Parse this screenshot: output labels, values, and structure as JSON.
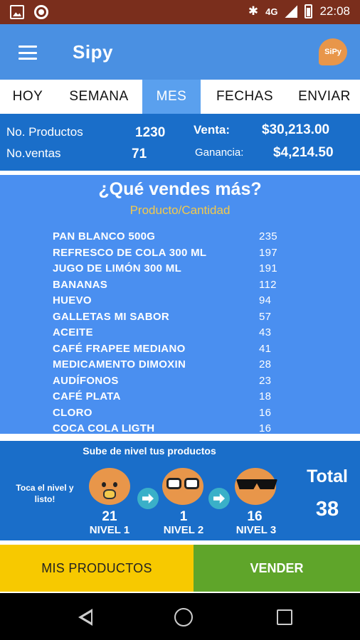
{
  "status_bar": {
    "network": "4G",
    "time": "22:08"
  },
  "app": {
    "title": "Sipy",
    "logo_text": "SiPy"
  },
  "tabs": [
    {
      "label": "HOY",
      "active": false
    },
    {
      "label": "SEMANA",
      "active": false
    },
    {
      "label": "MES",
      "active": true
    },
    {
      "label": "FECHAS",
      "active": false
    },
    {
      "label": "ENVIAR",
      "active": false
    }
  ],
  "summary": {
    "products_label": "No. Productos",
    "products_value": "1230",
    "sales_count_label": "No.ventas",
    "sales_count_value": "71",
    "revenue_label": "Venta:",
    "revenue_value": "$30,213.00",
    "profit_label": "Ganancia:",
    "profit_value": "$4,214.50"
  },
  "top_products": {
    "title": "¿Qué vendes más?",
    "subtitle": "Producto/Cantidad",
    "items": [
      {
        "name": "PAN BLANCO 500G",
        "qty": "235"
      },
      {
        "name": "REFRESCO DE COLA 300 ML",
        "qty": "197"
      },
      {
        "name": "JUGO DE LIMÓN 300 ML",
        "qty": "191"
      },
      {
        "name": "BANANAS",
        "qty": "112"
      },
      {
        "name": "HUEVO",
        "qty": "94"
      },
      {
        "name": "GALLETAS MI SABOR",
        "qty": "57"
      },
      {
        "name": "ACEITE",
        "qty": "43"
      },
      {
        "name": "CAFÉ FRAPEE MEDIANO",
        "qty": "41"
      },
      {
        "name": "MEDICAMENTO DIMOXIN",
        "qty": "28"
      },
      {
        "name": "AUDÍFONOS",
        "qty": "23"
      },
      {
        "name": "CAFÉ PLATA",
        "qty": "18"
      },
      {
        "name": "CLORO",
        "qty": "16"
      },
      {
        "name": "COCA COLA LIGTH",
        "qty": "16"
      }
    ]
  },
  "levels": {
    "title": "Sube de nivel tus productos",
    "hint": "Toca el nivel y listo!",
    "items": [
      {
        "count": "21",
        "label": "NIVEL 1",
        "icon": "baby-face-icon"
      },
      {
        "count": "1",
        "label": "NIVEL 2",
        "icon": "glasses-face-icon"
      },
      {
        "count": "16",
        "label": "NIVEL 3",
        "icon": "sunglasses-face-icon"
      }
    ],
    "total_label": "Total",
    "total_value": "38"
  },
  "actions": {
    "my_products": "MIS PRODUCTOS",
    "sell": "VENDER"
  },
  "colors": {
    "status_bar": "#7a2e1c",
    "app_bar": "#4a90e2",
    "active_tab": "#5aa0ee",
    "summary_bg": "#1a6ec9",
    "list_bg": "#4a8ff0",
    "subtitle": "#f2c94c",
    "face": "#e8964a",
    "mis_productos": "#f7c900",
    "vender": "#5fa52a"
  }
}
